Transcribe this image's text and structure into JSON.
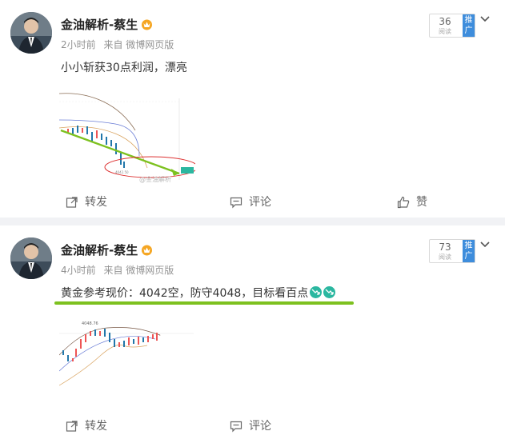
{
  "posts": [
    {
      "author": "金油解析-蔡生",
      "time": "2小时前",
      "source": "来自 微博网页版",
      "content": "小小斩获30点利润，漂亮",
      "reads": "36",
      "reads_label": "阅读",
      "promo": "推广",
      "chart": {
        "label": "4042.50",
        "watermark": "@金油解析"
      },
      "actions": {
        "forward": "转发",
        "comment": "评论",
        "like": "赞"
      }
    },
    {
      "author": "金油解析-蔡生",
      "time": "4小时前",
      "source": "来自 微博网页版",
      "content": "黄金参考现价：4042空，防守4048，目标看百点",
      "reads": "73",
      "reads_label": "阅读",
      "promo": "推广",
      "chart": {
        "label": "4048.76"
      },
      "actions": {
        "forward": "转发",
        "comment": "评论"
      }
    }
  ],
  "colors": {
    "accent": "#3e8ddc",
    "highlight": "#7dc11f",
    "down_emoji": "#2bb7a0"
  }
}
